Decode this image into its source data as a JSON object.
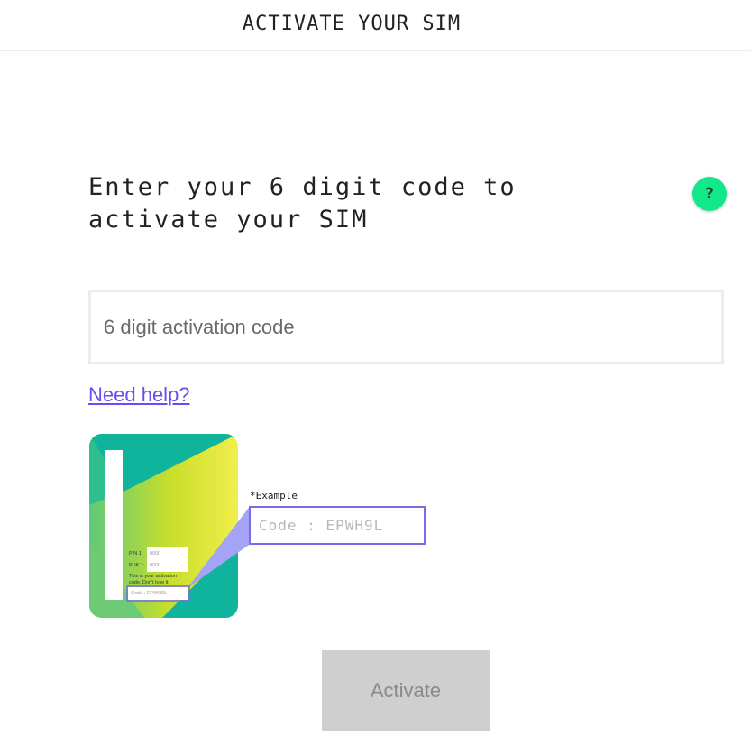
{
  "header": {
    "title": "ACTIVATE YOUR SIM"
  },
  "main": {
    "heading_line1": "Enter your 6 digit code to",
    "heading_line2": "activate your SIM",
    "help_icon_symbol": "?",
    "code_input": {
      "placeholder": "6 digit activation code",
      "value": ""
    },
    "need_help_link": "Need help?",
    "activate_button": "Activate"
  },
  "illustration": {
    "example_label": "*Example",
    "example_code": "Code : EPWH9L",
    "pin_label": "PIN 1:",
    "pin_value": "0000",
    "puk_label": "PUK 1:",
    "puk_value": "0000",
    "note_line1": "This is your activation",
    "note_line2": "code. Don't lose it.",
    "mini_code": "Code : EPWH9L"
  },
  "colors": {
    "accent_green": "#11e88a",
    "link_purple": "#6b4cf0",
    "button_disabled": "#cfcfcf",
    "highlight_blue": "#7b6be6"
  }
}
